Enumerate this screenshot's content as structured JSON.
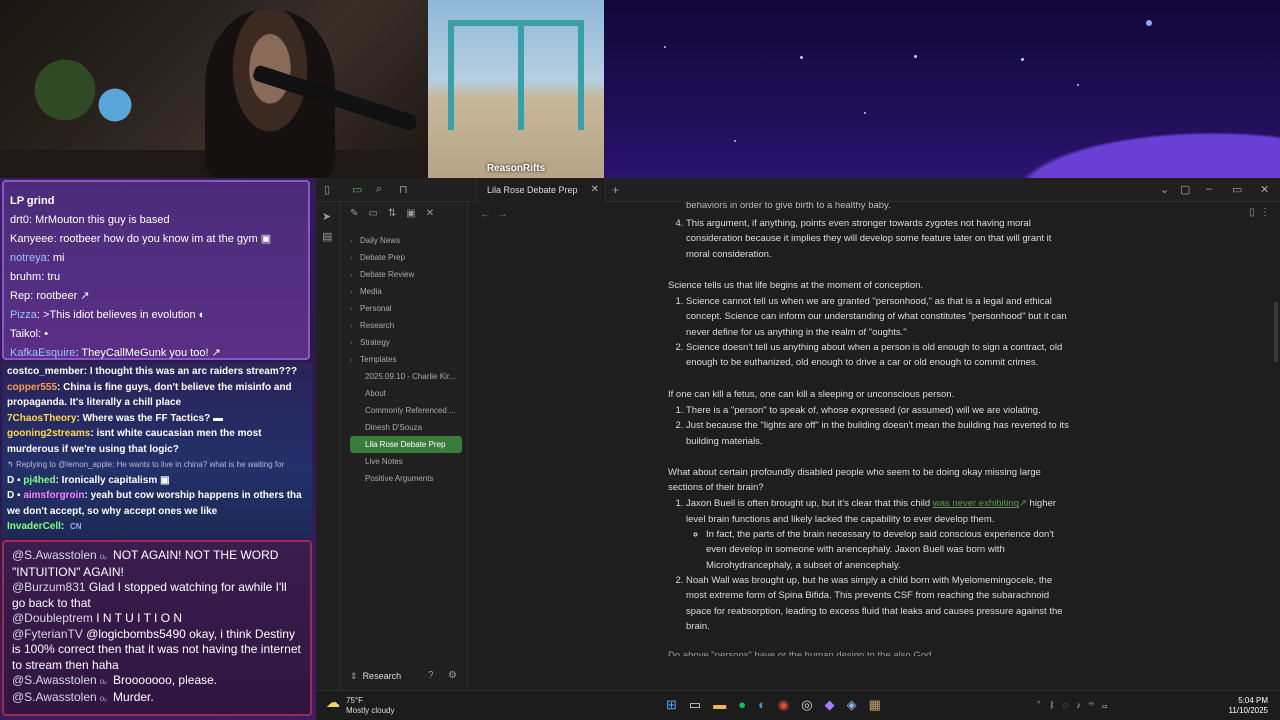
{
  "stream": {
    "beach_label": "ReasonRifts"
  },
  "chat_top": {
    "header": "LP grind",
    "messages": [
      {
        "user": "drt0",
        "text": "MrMouton this guy is based",
        "color": "#ffffff"
      },
      {
        "user": "Kanyeee",
        "text": "rootbeer how do you know im at the gym",
        "color": "#ffffff"
      },
      {
        "user": "notreya",
        "text": "mi",
        "color": "#9ec3ff"
      },
      {
        "user": "bruhm",
        "text": "tru",
        "color": "#ffffff"
      },
      {
        "user": "Rep",
        "text": "rootbeer",
        "color": "#ffffff"
      },
      {
        "user": "Pizza",
        "text": ">This idiot believes in evolution",
        "color": "#9ec3ff"
      },
      {
        "user": "Taikol",
        "text": "",
        "color": "#ffffff"
      },
      {
        "user": "KafkaEsquire",
        "text": "TheyCallMeGunk you too!",
        "color": "#9ec3ff"
      }
    ]
  },
  "chat_mid": {
    "messages": [
      {
        "user": "costco_member",
        "text": "I thought this was an arc raiders stream???",
        "color": "#ffffff"
      },
      {
        "user": "copper555",
        "text": "China is fine guys, don't believe the misinfo and propaganda. It's literally a chill place",
        "color": "#ff9a4d"
      },
      {
        "user": "7ChaosTheory",
        "text": "Where was the FF Tactics?",
        "color": "#ffd84d"
      },
      {
        "user": "gooning2streams",
        "text": "isnt white caucasian men the most murderous if we're using that logic?",
        "color": "#ffd84d"
      },
      {
        "user": "reply",
        "text": "Replying to @lemon_apple: He wants to live in china? what is he waiting for",
        "color": "#b9b9d8"
      },
      {
        "user": "pj4hed",
        "text": "Ironically capitalism",
        "color": "#7dff7d"
      },
      {
        "user": "aimsforgroin",
        "text": "yeah but cow worship happens in others tha we don't accept, so why accept ones we like",
        "color": "#ff7dff"
      },
      {
        "user": "InvaderCell",
        "text": "",
        "color": "#7dff7d"
      }
    ]
  },
  "chat_bottom": {
    "messages": [
      {
        "user": "@S.Awasstolen",
        "text": "NOT AGAIN! NOT THE WORD \"INTUITION\" AGAIN!"
      },
      {
        "user": "@Burzum831",
        "text": "Glad I stopped watching for awhile I'll go back to that"
      },
      {
        "user": "@Doubleptrem",
        "text": "I N T U I T I O N"
      },
      {
        "user": "@FyterianTV",
        "text": "@logicbombs5490 okay, i think Destiny is 100% correct then that it was not having the internet to stream then haha"
      },
      {
        "user": "@S.Awasstolen",
        "text": "Brooooooo, please."
      },
      {
        "user": "@S.Awasstolen",
        "text": "Murder."
      }
    ]
  },
  "obsidian": {
    "tab_title": "Lila Rose Debate Prep",
    "sidebar_footer": "Research",
    "folders": [
      "Daily News",
      "Debate Prep",
      "Debate Review",
      "Media",
      "Personal",
      "Research",
      "Strategy",
      "Templates"
    ],
    "files": [
      "2025.09.10 - Charlie Kir...",
      "About",
      "Commonly Referenced ...",
      "Dinesh D'Souza",
      "Lila Rose Debate Prep",
      "Live Notes",
      "Positive Arguments"
    ],
    "active_file": "Lila Rose Debate Prep",
    "accent": "#3a7d3a",
    "content": {
      "partial_top": "behaviors in order to give birth to a healthy baby.",
      "item4": "This argument, if anything, points even stronger towards zygotes not having moral consideration because it implies they will develop some feature later on that will grant it moral consideration.",
      "p1": "Science tells us that life begins at the moment of conception.",
      "p1_items": [
        "Science cannot tell us when we are granted \"personhood,\" as that is a legal and ethical concept. Science can inform our understanding of what constitutes \"personhood\" but it can never define for us anything in the realm of \"oughts.\"",
        "Science doesn't tell us anything about when a person is old enough to sign a contract, old enough to be euthanized, old enough to drive a car or old enough to commit crimes."
      ],
      "p2": "If one can kill a fetus, one can kill a sleeping or unconscious person.",
      "p2_items": [
        "There is a \"person\" to speak of, whose expressed (or assumed) will we are violating.",
        "Just because the \"lights are off\" in the building doesn't mean the building has reverted to its building materials."
      ],
      "p3": "What about certain profoundly disabled people who seem to be doing okay missing large sections of their brain?",
      "p3_item1_pre": "Jaxon Buell is often brought up, but it's clear that this child ",
      "p3_item1_link": "was never exhibiting",
      "p3_item1_post": " higher level brain functions and likely lacked the capability to ever develop them.",
      "p3_sub": "In fact, the parts of the brain necessary to develop said conscious experience don't even develop in someone with anencephaly. Jaxon Buell was born with Microhydrancephaly, a subset of anencephaly.",
      "p3_item2": "Noah Wall was brought up, but he was simply a child born with Myelomemingocele, the most extreme form of Spina Bifida. This prevents CSF from reaching the subarachnoid space for reabsorption, leading to excess fluid that leaks and causes pressure against the brain.",
      "partial_bottom": "Do above \"persons\" have or the human design to the also God..."
    }
  },
  "taskbar": {
    "temp": "75°F",
    "condition": "Mostly cloudy",
    "time": "5:04 PM",
    "date": "11/10/2025"
  }
}
